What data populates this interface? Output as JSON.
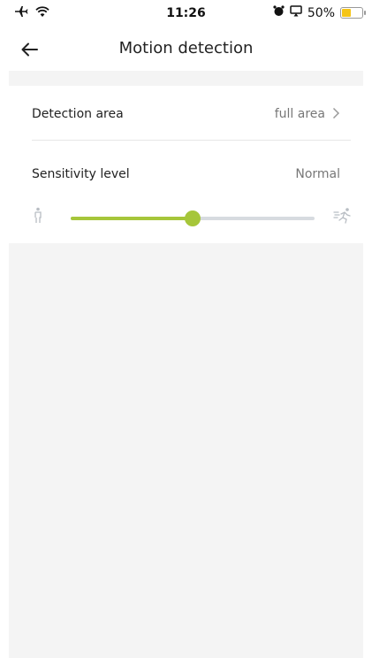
{
  "status_bar": {
    "time": "11:26",
    "battery_percent": "50%",
    "icons": [
      "airplane-icon",
      "wifi-icon",
      "alarm-icon",
      "screen-mirroring-icon",
      "battery-icon"
    ]
  },
  "header": {
    "title": "Motion detection",
    "back_icon": "arrow-left-icon"
  },
  "settings": {
    "detection_area": {
      "label": "Detection area",
      "value": "full area"
    },
    "sensitivity": {
      "label": "Sensitivity level",
      "value": "Normal",
      "slider_fraction": 0.5,
      "low_icon": "standing-person-icon",
      "high_icon": "running-person-icon"
    }
  },
  "colors": {
    "accent": "#a6c63a",
    "track": "#d7dbe0",
    "background": "#f4f4f4",
    "battery": "#f5c518"
  }
}
